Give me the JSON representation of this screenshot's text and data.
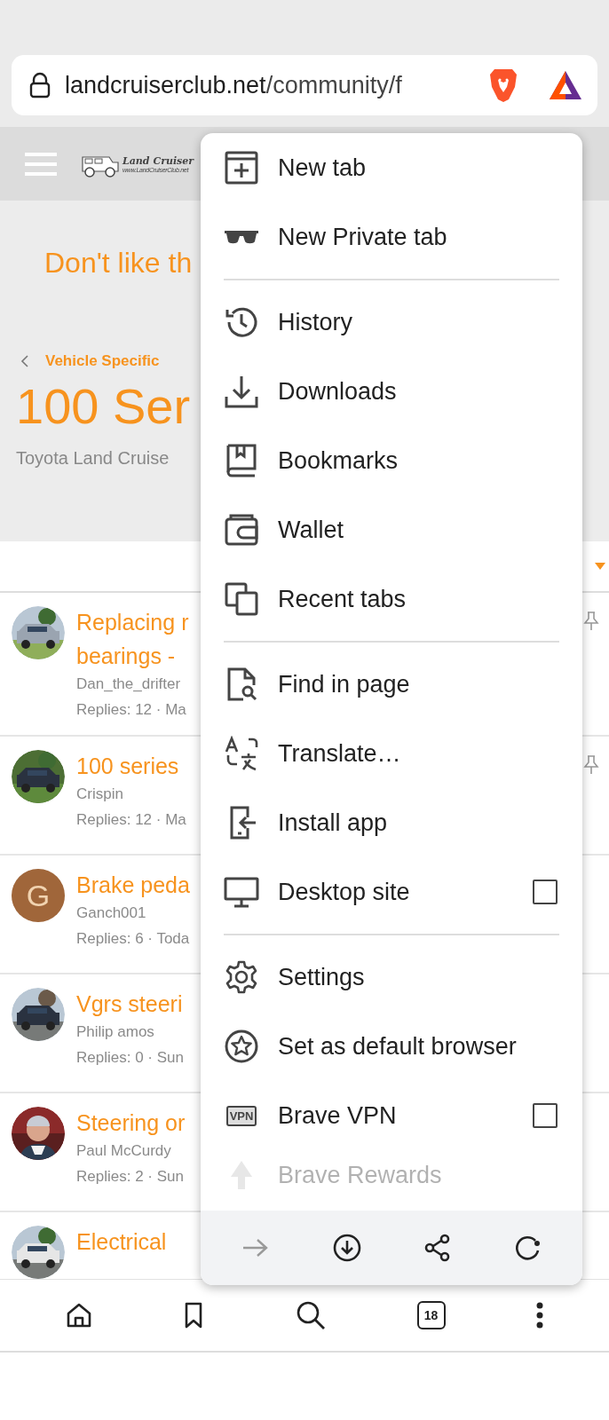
{
  "url_bar": {
    "domain": "landcruiserclub.net",
    "path": "/community/f"
  },
  "site_header": {
    "logo_title": "Land Cruiser",
    "logo_url": "www.LandCruiserClub.net"
  },
  "hero": {
    "notice": "Don't like th",
    "breadcrumb": "Vehicle Specific",
    "title": "100 Ser",
    "subtitle": "Toyota Land Cruise"
  },
  "threads": [
    {
      "avatar": {
        "kind": "picture"
      },
      "title_lines": [
        "Replacing r",
        "bearings -"
      ],
      "author": "Dan_the_drifter",
      "meta": "Replies: 12 · Ma",
      "pinned": true
    },
    {
      "avatar": {
        "kind": "picture"
      },
      "title_lines": [
        "100 series"
      ],
      "author": "Crispin",
      "meta": "Replies: 12 · Ma",
      "pinned": true
    },
    {
      "avatar": {
        "kind": "letter",
        "letter": "G",
        "color": "#a0663a"
      },
      "title_lines": [
        "Brake peda"
      ],
      "author": "Ganch001",
      "meta": "Replies: 6 · Toda",
      "pinned": false
    },
    {
      "avatar": {
        "kind": "picture"
      },
      "title_lines": [
        "Vgrs steeri"
      ],
      "author": "Philip amos",
      "meta": "Replies: 0 · Sun",
      "pinned": false
    },
    {
      "avatar": {
        "kind": "picture"
      },
      "title_lines": [
        "Steering or"
      ],
      "author": "Paul McCurdy",
      "meta": "Replies: 2 · Sun",
      "pinned": false
    },
    {
      "avatar": {
        "kind": "picture"
      },
      "title_lines": [
        "Electrical"
      ],
      "pinned": false
    }
  ],
  "menu": {
    "items": [
      {
        "kind": "item",
        "label": "New tab"
      },
      {
        "kind": "item",
        "label": "New Private tab"
      },
      {
        "kind": "divider"
      },
      {
        "kind": "item",
        "label": "History"
      },
      {
        "kind": "item",
        "label": "Downloads"
      },
      {
        "kind": "item",
        "label": "Bookmarks"
      },
      {
        "kind": "item",
        "label": "Wallet"
      },
      {
        "kind": "item",
        "label": "Recent tabs"
      },
      {
        "kind": "divider"
      },
      {
        "kind": "item",
        "label": "Find in page"
      },
      {
        "kind": "item",
        "label": "Translate…"
      },
      {
        "kind": "item",
        "label": "Install app"
      },
      {
        "kind": "checkbox",
        "label": "Desktop site",
        "checked": false
      },
      {
        "kind": "divider"
      },
      {
        "kind": "item",
        "label": "Settings"
      },
      {
        "kind": "item",
        "label": "Set as default browser"
      },
      {
        "kind": "checkbox",
        "icon_text": "VPN",
        "label": "Brave VPN",
        "checked": false
      },
      {
        "kind": "item",
        "label": "Brave Rewards",
        "faded": true
      }
    ],
    "toolbar": [
      {
        "disabled": true
      },
      {
        "disabled": false
      },
      {
        "disabled": false
      },
      {
        "disabled": false
      }
    ]
  },
  "bottom_nav": {
    "tab_count": "18"
  }
}
